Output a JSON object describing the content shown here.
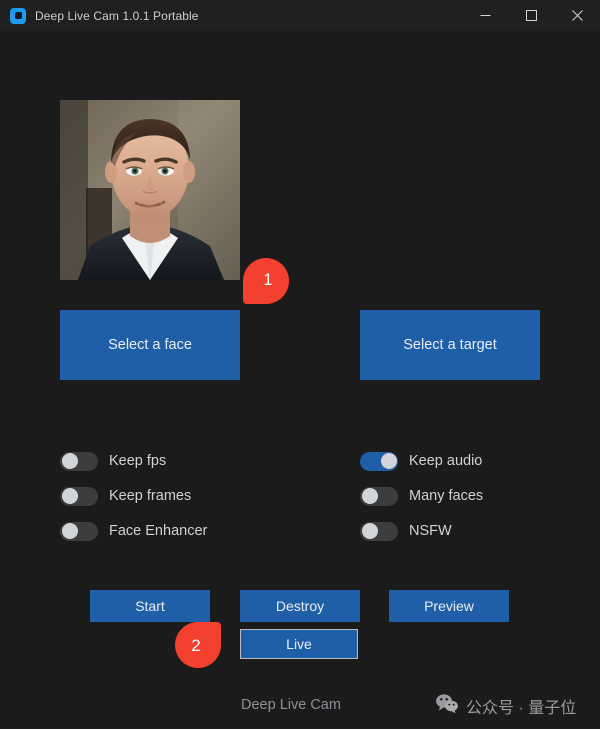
{
  "window": {
    "title": "Deep Live Cam 1.0.1 Portable",
    "icon": "app-logo-icon",
    "controls": {
      "minimize": "minimize-icon",
      "maximize": "maximize-icon",
      "close": "close-icon"
    }
  },
  "colors": {
    "accent_blue": "#1f5fa8",
    "window_bg": "#1b1b1b",
    "titlebar_bg": "#202020",
    "marker_red": "#f4402f",
    "toggle_off_track": "#3d3d3d",
    "toggle_knob": "#d2d5d8",
    "label_text": "#cfd2d6"
  },
  "previews": {
    "face": {
      "name": "selected-face-preview",
      "has_image": true,
      "alt": "portrait photo of a man in a dark suit and white shirt"
    },
    "target": {
      "name": "selected-target-preview",
      "has_image": false,
      "alt": ""
    }
  },
  "main_buttons": {
    "select_face": "Select a face",
    "select_target": "Select a target"
  },
  "switches": {
    "left": [
      {
        "label": "Keep fps",
        "on": false
      },
      {
        "label": "Keep frames",
        "on": false
      },
      {
        "label": "Face Enhancer",
        "on": false
      }
    ],
    "right": [
      {
        "label": "Keep audio",
        "on": true
      },
      {
        "label": "Many faces",
        "on": false
      },
      {
        "label": "NSFW",
        "on": false
      }
    ]
  },
  "actions": {
    "start": "Start",
    "destroy": "Destroy",
    "preview": "Preview",
    "live": "Live"
  },
  "footer": {
    "link": "Deep Live Cam",
    "watermark_icon": "wechat-icon",
    "watermark_text": "公众号 · 量子位"
  },
  "markers": [
    {
      "number": "1",
      "points_to": "Select a face"
    },
    {
      "number": "2",
      "points_to": "Live"
    }
  ]
}
